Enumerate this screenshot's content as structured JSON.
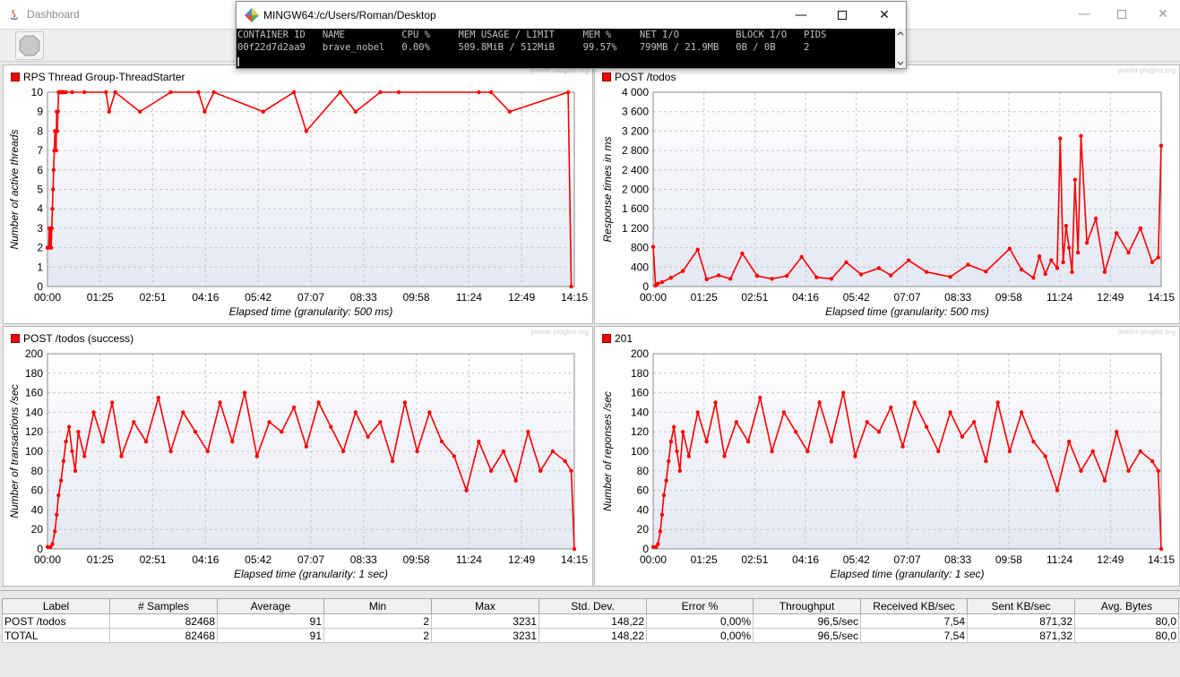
{
  "window": {
    "title": "Dashboard"
  },
  "terminal": {
    "title": "MINGW64:/c/Users/Roman/Desktop",
    "header_line": "CONTAINER ID   NAME          CPU %     MEM USAGE / LIMIT     MEM %     NET I/O          BLOCK I/O   PIDS",
    "data_line": "00f22d7d2aa9   brave_nobel   0.00%     509.8MiB / 512MiB     99.57%    799MB / 21.9MB   0B / 0B     2"
  },
  "watermark": "jmeter-plugins.org",
  "colors": {
    "series": "#ff0000",
    "grid": "#c9c9c9",
    "plot_bg_top": "#ffffff",
    "plot_bg_bottom": "#e4e8f3"
  },
  "chart_data": [
    {
      "type": "line",
      "title": "RPS Thread Group-ThreadStarter",
      "xlabel": "Elapsed time (granularity: 500 ms)",
      "ylabel": "Number of active threads",
      "ylim": [
        0,
        10
      ],
      "yticks": [
        "0",
        "1",
        "2",
        "3",
        "4",
        "5",
        "6",
        "7",
        "8",
        "9",
        "10"
      ],
      "xticks": [
        "00:00",
        "01:25",
        "02:51",
        "04:16",
        "05:42",
        "07:07",
        "08:33",
        "09:58",
        "11:24",
        "12:49",
        "14:15"
      ],
      "x_unit": "seconds",
      "x": [
        0,
        0.5,
        1,
        2,
        3,
        4,
        5,
        6,
        7,
        8,
        9,
        10,
        11,
        12,
        13,
        14,
        15,
        16,
        17,
        18,
        19,
        20,
        21,
        22,
        23,
        24,
        25,
        26,
        27,
        30,
        40,
        60,
        95,
        100,
        110,
        150,
        200,
        245,
        255,
        270,
        350,
        400,
        420,
        475,
        500,
        540,
        570,
        700,
        720,
        750,
        845,
        850
      ],
      "values": [
        2,
        2,
        2,
        2,
        3,
        2,
        3,
        2,
        3,
        4,
        5,
        6,
        7,
        8,
        8,
        7,
        9,
        8,
        9,
        10,
        10,
        10,
        10,
        10,
        10,
        10,
        10,
        10,
        10,
        10,
        10,
        10,
        10,
        9,
        10,
        9,
        10,
        10,
        9,
        10,
        9,
        10,
        8,
        10,
        9,
        10,
        10,
        10,
        10,
        9,
        10,
        0
      ]
    },
    {
      "type": "line",
      "title": "POST /todos",
      "xlabel": "Elapsed time (granularity: 500 ms)",
      "ylabel": "Response times in ms",
      "ylim": [
        0,
        4000
      ],
      "yticks": [
        "0",
        "400",
        "800",
        "1 200",
        "1 600",
        "2 000",
        "2 400",
        "2 800",
        "3 200",
        "3 600",
        "4 000"
      ],
      "xticks": [
        "00:00",
        "01:25",
        "02:51",
        "04:16",
        "05:42",
        "07:07",
        "08:33",
        "09:58",
        "11:24",
        "12:49",
        "14:15"
      ],
      "x_unit": "seconds",
      "x": [
        0,
        4,
        8,
        15,
        30,
        50,
        75,
        90,
        110,
        130,
        150,
        175,
        200,
        225,
        250,
        275,
        300,
        325,
        350,
        380,
        400,
        430,
        460,
        500,
        530,
        560,
        600,
        620,
        640,
        650,
        660,
        670,
        680,
        685,
        690,
        695,
        700,
        705,
        710,
        715,
        720,
        730,
        745,
        760,
        780,
        800,
        820,
        840,
        850,
        855
      ],
      "values": [
        820,
        20,
        60,
        90,
        180,
        320,
        760,
        150,
        230,
        160,
        680,
        220,
        160,
        220,
        610,
        190,
        160,
        500,
        250,
        380,
        230,
        540,
        300,
        200,
        450,
        310,
        780,
        350,
        180,
        620,
        260,
        540,
        380,
        3050,
        500,
        1250,
        800,
        300,
        2200,
        700,
        3100,
        900,
        1400,
        300,
        1100,
        700,
        1200,
        500,
        600,
        2900
      ]
    },
    {
      "type": "line",
      "title": "POST /todos (success)",
      "xlabel": "Elapsed time (granularity: 1 sec)",
      "ylabel": "Number of transactions /sec",
      "ylim": [
        0,
        200
      ],
      "yticks": [
        "0",
        "20",
        "40",
        "60",
        "80",
        "100",
        "120",
        "140",
        "160",
        "180",
        "200"
      ],
      "xticks": [
        "00:00",
        "01:25",
        "02:51",
        "04:16",
        "05:42",
        "07:07",
        "08:33",
        "09:58",
        "11:24",
        "12:49",
        "14:15"
      ],
      "x_unit": "seconds",
      "x": [
        0,
        5,
        8,
        12,
        15,
        18,
        22,
        26,
        30,
        35,
        40,
        45,
        50,
        60,
        75,
        90,
        105,
        120,
        140,
        160,
        180,
        200,
        220,
        240,
        260,
        280,
        300,
        320,
        340,
        360,
        380,
        400,
        420,
        440,
        460,
        480,
        500,
        520,
        540,
        560,
        580,
        600,
        620,
        640,
        660,
        680,
        700,
        720,
        740,
        760,
        780,
        800,
        820,
        840,
        850,
        855
      ],
      "values": [
        2,
        2,
        5,
        18,
        35,
        55,
        70,
        90,
        110,
        125,
        100,
        80,
        120,
        95,
        140,
        110,
        150,
        95,
        130,
        110,
        155,
        100,
        140,
        120,
        100,
        150,
        110,
        160,
        95,
        130,
        120,
        145,
        105,
        150,
        125,
        100,
        140,
        115,
        130,
        90,
        150,
        100,
        140,
        110,
        95,
        60,
        110,
        80,
        100,
        70,
        120,
        80,
        100,
        90,
        80,
        0
      ]
    },
    {
      "type": "line",
      "title": "201",
      "xlabel": "Elapsed time (granularity: 1 sec)",
      "ylabel": "Number of reponses /sec",
      "ylim": [
        0,
        200
      ],
      "yticks": [
        "0",
        "20",
        "40",
        "60",
        "80",
        "100",
        "120",
        "140",
        "160",
        "180",
        "200"
      ],
      "xticks": [
        "00:00",
        "01:25",
        "02:51",
        "04:16",
        "05:42",
        "07:07",
        "08:33",
        "09:58",
        "11:24",
        "12:49",
        "14:15"
      ],
      "x_unit": "seconds",
      "x": [
        0,
        5,
        8,
        12,
        15,
        18,
        22,
        26,
        30,
        35,
        40,
        45,
        50,
        60,
        75,
        90,
        105,
        120,
        140,
        160,
        180,
        200,
        220,
        240,
        260,
        280,
        300,
        320,
        340,
        360,
        380,
        400,
        420,
        440,
        460,
        480,
        500,
        520,
        540,
        560,
        580,
        600,
        620,
        640,
        660,
        680,
        700,
        720,
        740,
        760,
        780,
        800,
        820,
        840,
        850,
        855
      ],
      "values": [
        2,
        2,
        5,
        18,
        35,
        55,
        70,
        90,
        110,
        125,
        100,
        80,
        120,
        95,
        140,
        110,
        150,
        95,
        130,
        110,
        155,
        100,
        140,
        120,
        100,
        150,
        110,
        160,
        95,
        130,
        120,
        145,
        105,
        150,
        125,
        100,
        140,
        115,
        130,
        90,
        150,
        100,
        140,
        110,
        95,
        60,
        110,
        80,
        100,
        70,
        120,
        80,
        100,
        90,
        80,
        0
      ]
    }
  ],
  "table": {
    "headers": [
      "Label",
      "# Samples",
      "Average",
      "Min",
      "Max",
      "Std. Dev.",
      "Error %",
      "Throughput",
      "Received KB/sec",
      "Sent KB/sec",
      "Avg. Bytes"
    ],
    "rows": [
      [
        "POST /todos",
        "82468",
        "91",
        "2",
        "3231",
        "148,22",
        "0,00%",
        "96,5/sec",
        "7,54",
        "871,32",
        "80,0"
      ],
      [
        "TOTAL",
        "82468",
        "91",
        "2",
        "3231",
        "148,22",
        "0,00%",
        "96,5/sec",
        "7,54",
        "871,32",
        "80,0"
      ]
    ]
  }
}
